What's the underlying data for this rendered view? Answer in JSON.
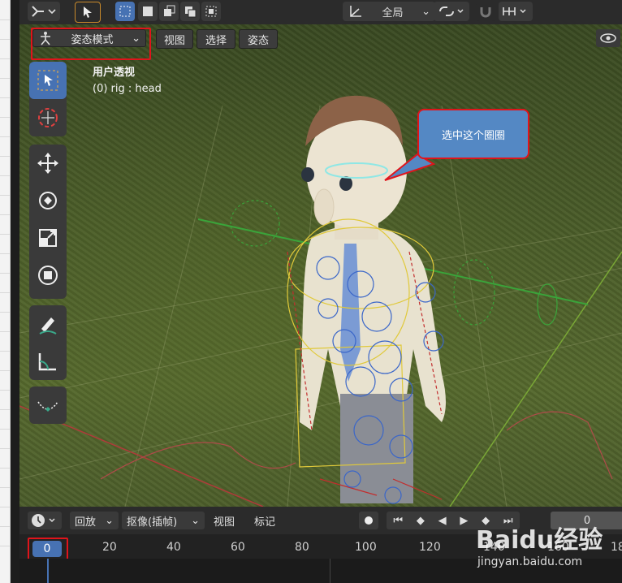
{
  "toolbar": {
    "transform_orientation": "全局"
  },
  "viewport_header": {
    "mode": "姿态模式",
    "menu": [
      "视图",
      "选择",
      "姿态"
    ]
  },
  "viewport": {
    "view_name": "用户透视",
    "active_object": "(0) rig : head"
  },
  "callout": {
    "text": "选中这个圈圈"
  },
  "timeline": {
    "playback": "回放",
    "keying": "抠像(插帧)",
    "view": "视图",
    "marker": "标记",
    "current_frame": "0",
    "ruler_current": "0",
    "ruler_ticks": [
      "20",
      "40",
      "60",
      "80",
      "100",
      "120",
      "140",
      "160",
      "18"
    ]
  },
  "watermark": {
    "brand": "Baidu经验",
    "url": "jingyan.baidu.com"
  },
  "colors": {
    "accent": "#4772b3",
    "highlight_box": "#e0141b",
    "callout_bg": "#5488c4"
  }
}
